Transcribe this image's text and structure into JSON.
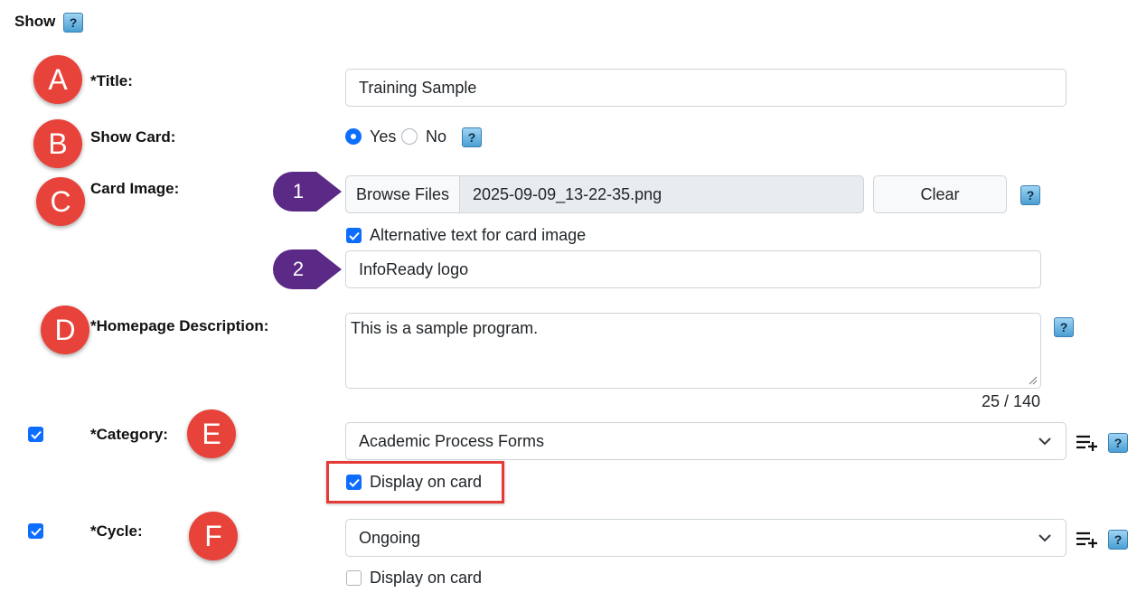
{
  "section": {
    "title": "Show",
    "help": "?"
  },
  "markers": {
    "a": "A",
    "b": "B",
    "c": "C",
    "d": "D",
    "e": "E",
    "f": "F",
    "p1": "1",
    "p2": "2"
  },
  "title_field": {
    "label": "*Title:",
    "value": "Training Sample"
  },
  "show_card": {
    "label": "Show Card:",
    "yes": "Yes",
    "no": "No",
    "selected": "Yes",
    "help": "?"
  },
  "card_image": {
    "label": "Card Image:",
    "browse_label": "Browse Files",
    "filename": "2025-09-09_13-22-35.png",
    "clear_label": "Clear",
    "help": "?",
    "alt_checkbox_label": "Alternative text for card image",
    "alt_checked": true,
    "alt_value": "InfoReady logo"
  },
  "homepage_description": {
    "label": "*Homepage Description:",
    "value": "This is a sample program.",
    "counter": "25 / 140",
    "help": "?"
  },
  "category": {
    "label": "*Category:",
    "selected": "Academic Process Forms",
    "enabled": true,
    "display_on_card_label": "Display on card",
    "display_on_card": true,
    "help": "?"
  },
  "cycle": {
    "label": "*Cycle:",
    "selected": "Ongoing",
    "enabled": true,
    "display_on_card_label": "Display on card",
    "display_on_card": false,
    "help": "?"
  },
  "colors": {
    "marker_red": "#e8433a",
    "marker_purple": "#5b2a86",
    "checkbox_blue": "#0d6efd",
    "highlight_red": "#e53935"
  }
}
